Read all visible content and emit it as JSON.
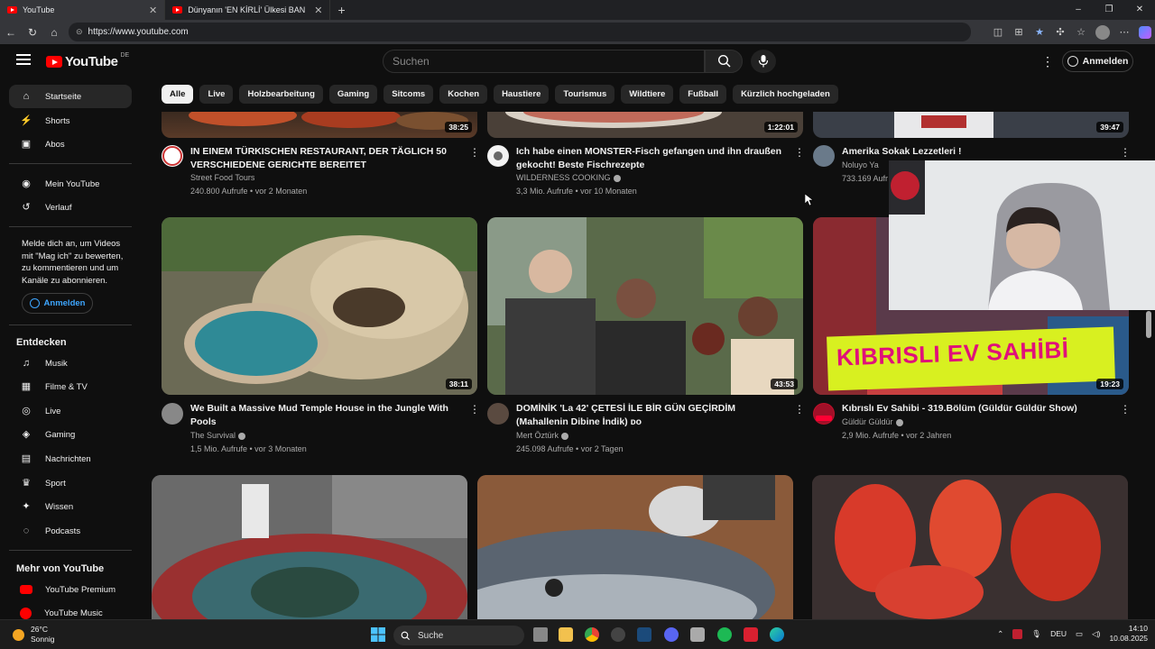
{
  "browser": {
    "tabs": [
      {
        "title": "YouTube",
        "active": true
      },
      {
        "title": "Dünyanın 'EN KİRLİ' Ülkesi BANG",
        "active": false
      }
    ],
    "url": "https://www.youtube.com",
    "window_controls": {
      "minimize": "–",
      "restore": "❐",
      "close": "✕"
    },
    "new_tab": "+"
  },
  "header": {
    "logo_text": "YouTube",
    "logo_region": "DE",
    "search_placeholder": "Suchen",
    "signin_label": "Anmelden"
  },
  "chips": [
    "Alle",
    "Live",
    "Holzbearbeitung",
    "Gaming",
    "Sitcoms",
    "Kochen",
    "Haustiere",
    "Tourismus",
    "Wildtiere",
    "Fußball",
    "Kürzlich hochgeladen"
  ],
  "sidebar": {
    "main": [
      {
        "label": "Startseite",
        "icon": "home-icon",
        "glyph": "⌂"
      },
      {
        "label": "Shorts",
        "icon": "shorts-icon",
        "glyph": "⚡"
      },
      {
        "label": "Abos",
        "icon": "subscriptions-icon",
        "glyph": "▣"
      }
    ],
    "you": [
      {
        "label": "Mein YouTube",
        "icon": "account-icon",
        "glyph": "◉"
      },
      {
        "label": "Verlauf",
        "icon": "history-icon",
        "glyph": "↺"
      }
    ],
    "signin_prompt": "Melde dich an, um Videos mit \"Mag ich\" zu bewerten, zu kommentieren und um Kanäle zu abonnieren.",
    "signin_label": "Anmelden",
    "explore_heading": "Entdecken",
    "explore": [
      {
        "label": "Musik",
        "icon": "music-icon",
        "glyph": "♫"
      },
      {
        "label": "Filme & TV",
        "icon": "film-icon",
        "glyph": "▦"
      },
      {
        "label": "Live",
        "icon": "live-icon",
        "glyph": "◎"
      },
      {
        "label": "Gaming",
        "icon": "gaming-icon",
        "glyph": "◈"
      },
      {
        "label": "Nachrichten",
        "icon": "news-icon",
        "glyph": "▤"
      },
      {
        "label": "Sport",
        "icon": "trophy-icon",
        "glyph": "♛"
      },
      {
        "label": "Wissen",
        "icon": "lightbulb-icon",
        "glyph": "✦"
      },
      {
        "label": "Podcasts",
        "icon": "podcast-icon",
        "glyph": "◌"
      }
    ],
    "more_heading": "Mehr von YouTube",
    "more": [
      {
        "label": "YouTube Premium"
      },
      {
        "label": "YouTube Music"
      }
    ]
  },
  "videos_row1": [
    {
      "title": "IN EINEM TÜRKISCHEN RESTAURANT, DER TÄGLICH 50 VERSCHIEDENE GERICHTE BEREITET",
      "channel": "Street Food Tours",
      "meta": "240.800 Aufrufe • vor 2 Monaten",
      "duration": "38:25",
      "verified": false
    },
    {
      "title": "Ich habe einen MONSTER-Fisch gefangen und ihn draußen gekocht! Beste Fischrezepte",
      "channel": "WILDERNESS COOKING",
      "meta": "3,3 Mio. Aufrufe • vor 10 Monaten",
      "duration": "1:22:01",
      "verified": true
    },
    {
      "title": "Amerika Sokak Lezzetleri !",
      "channel": "Noluyo Ya",
      "meta": "733.169 Aufr",
      "duration": "39:47",
      "verified": false
    }
  ],
  "videos_row2": [
    {
      "title": "We Built a Massive Mud Temple House in the Jungle With Pools",
      "channel": "The Survival",
      "meta": "1,5 Mio. Aufrufe • vor 3 Monaten",
      "duration": "38:11",
      "verified": true
    },
    {
      "title": "DOMİNİK 'La 42' ÇETESİ İLE BİR GÜN GEÇİRDİM (Mahallenin Dibine İndik) ᴅᴏ",
      "channel": "Mert Öztürk",
      "meta": "245.098 Aufrufe • vor 2 Tagen",
      "duration": "43:53",
      "verified": true
    },
    {
      "title": "Kıbrıslı Ev Sahibi - 319.Bölüm (Güldür Güldür Show)",
      "channel": "Güldür Güldür",
      "meta": "2,9 Mio. Aufrufe • vor 2 Jahren",
      "duration": "19:23",
      "verified": true,
      "banner": "KIBRISLI EV SAHİBİ"
    }
  ],
  "taskbar": {
    "weather_temp": "26°C",
    "weather_desc": "Sonnig",
    "search_label": "Suche",
    "lang": "DEU",
    "time": "14:10",
    "date": "10.08.2025"
  },
  "colors": {
    "accent": "#ff0000",
    "link": "#3ea6ff",
    "bg": "#0f0f0f"
  }
}
